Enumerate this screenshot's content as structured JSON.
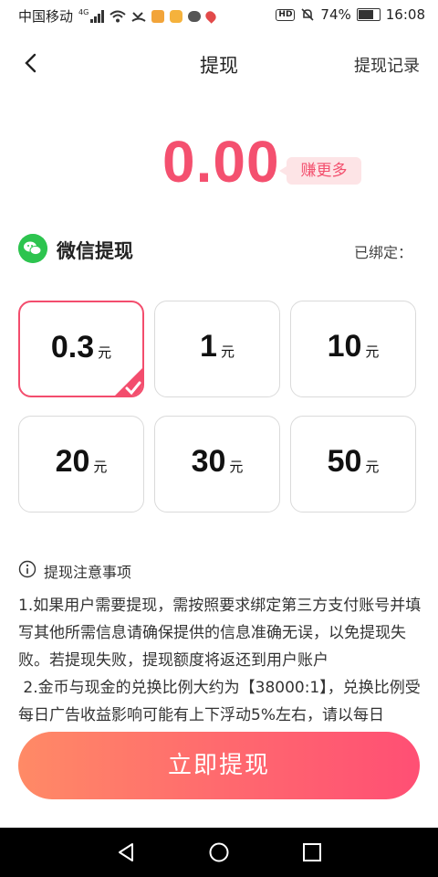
{
  "status_bar": {
    "carrier": "中国移动",
    "network": "4G",
    "battery": "74%",
    "time": "16:08"
  },
  "header": {
    "title": "提现",
    "record_link": "提现记录"
  },
  "balance": {
    "amount": "0.00",
    "earn_more": "赚更多"
  },
  "method": {
    "label": "微信提现",
    "bound_label": "已绑定："
  },
  "options": [
    {
      "value": "0.3",
      "unit": "元",
      "selected": true
    },
    {
      "value": "1",
      "unit": "元",
      "selected": false
    },
    {
      "value": "10",
      "unit": "元",
      "selected": false
    },
    {
      "value": "20",
      "unit": "元",
      "selected": false
    },
    {
      "value": "30",
      "unit": "元",
      "selected": false
    },
    {
      "value": "50",
      "unit": "元",
      "selected": false
    }
  ],
  "notes": {
    "title": "提现注意事项",
    "p1": "1.如果用户需要提现，需按照要求绑定第三方支付账号并填写其他所需信息请确保提供的信息准确无误，以免提现失败。若提现失败，提现额度将返还到用户账户",
    "p2": " 2.金币与现金的兑换比例大约为【38000:1】，兑换比例受每日广告收益影响可能有上下浮动5%左右，请以每日"
  },
  "submit_button": "立即提现",
  "colors": {
    "accent": "#f4506f",
    "wechat": "#2dc44f",
    "button_start": "#ff8a66",
    "button_end": "#ff4f74"
  }
}
